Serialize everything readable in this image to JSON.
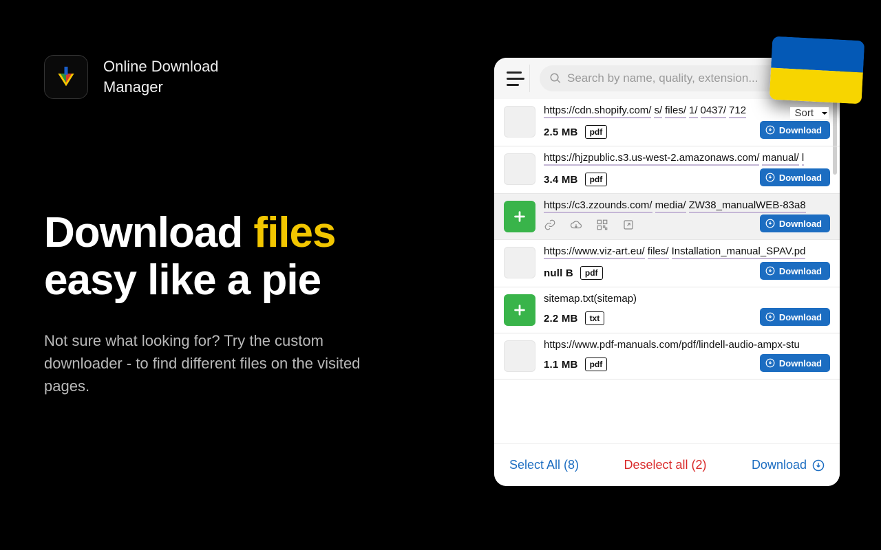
{
  "brand": {
    "line1": "Online Download",
    "line2": "Manager"
  },
  "headline": {
    "pre": "Download ",
    "accent": "files",
    "post": " easy like a pie"
  },
  "subhead": "Not sure what looking for? Try the custom downloader - to find different files on the visited pages.",
  "search": {
    "placeholder": "Search by name, quality, extension..."
  },
  "sort_label": "Sort",
  "download_button_label": "Download",
  "footer": {
    "select_all": "Select All (8)",
    "deselect_all": "Deselect all (2)",
    "download": "Download"
  },
  "rows": [
    {
      "thumb": "blank",
      "url_segments": [
        "https://cdn.shopify.com/",
        "s/",
        "files/",
        "1/",
        "0437/",
        "712"
      ],
      "size": "2.5 MB",
      "badge": "pdf",
      "style": "default"
    },
    {
      "thumb": "blank",
      "url_segments": [
        "https://hjzpublic.s3.us-west-2.amazonaws.com/",
        "manual/",
        "l"
      ],
      "size": "3.4 MB",
      "badge": "pdf",
      "style": "default"
    },
    {
      "thumb": "add",
      "url_segments": [
        "https://c3.zzounds.com/",
        "media/",
        "ZW38_manualWEB-83a8"
      ],
      "size": "",
      "badge": "",
      "style": "actions"
    },
    {
      "thumb": "blank",
      "url_segments": [
        "https://www.viz-art.eu/",
        "files/",
        "Installation_manual_SPAV.pd"
      ],
      "size": "null B",
      "badge": "pdf",
      "style": "default"
    },
    {
      "thumb": "add",
      "url_plain": "sitemap.txt(sitemap)",
      "size": "2.2 MB",
      "badge": "txt",
      "style": "default"
    },
    {
      "thumb": "blank",
      "url_plain": "https://www.pdf-manuals.com/pdf/lindell-audio-ampx-stu",
      "size": "1.1 MB",
      "badge": "pdf",
      "style": "default"
    }
  ]
}
